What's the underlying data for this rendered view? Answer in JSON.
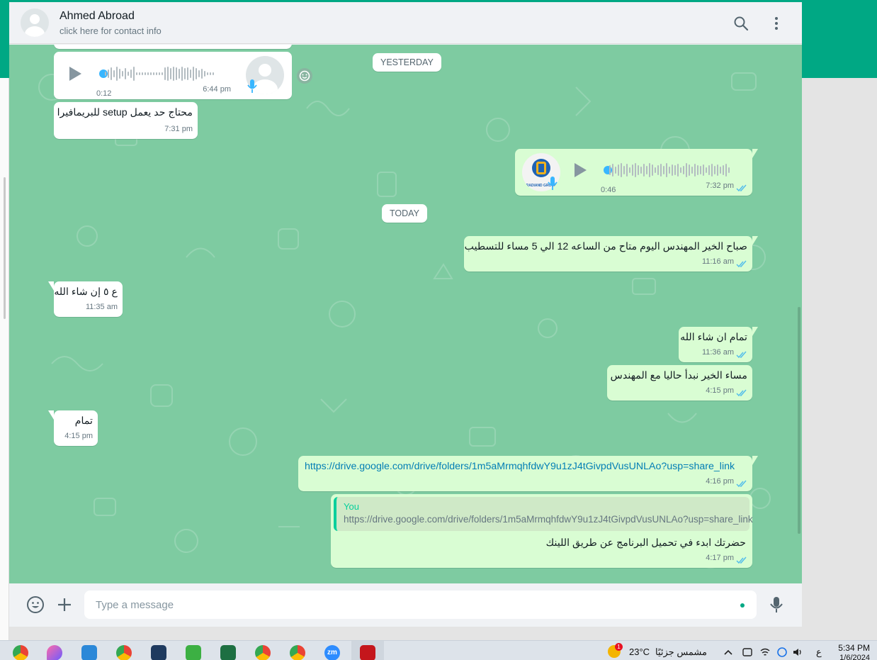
{
  "header": {
    "contact_name": "Ahmed Abroad",
    "contact_sub": "click here for contact info"
  },
  "icons": {
    "search": "search-icon",
    "menu": "more-vertical-icon",
    "emoji": "emoji-icon",
    "attach": "plus-icon",
    "mic": "mic-icon",
    "read": "double-check-icon",
    "react": "emoji-react-icon"
  },
  "colors": {
    "accent": "#00a884",
    "chat_bg": "#7ecba1",
    "out_bubble": "#d9fdd3",
    "in_bubble": "#ffffff",
    "link": "#027eb5",
    "read_ticks": "#53bdeb"
  },
  "dates": {
    "yesterday": "YESTERDAY",
    "today": "TODAY"
  },
  "messages": {
    "voice_in": {
      "duration": "0:12",
      "time": "6:44 pm"
    },
    "in_setup": {
      "text": "محتاج حد يعمل setup للبريمافيرا",
      "time": "7:31 pm"
    },
    "voice_out": {
      "duration": "0:46",
      "time": "7:32 pm",
      "logo_text": "RADIAND GROUP"
    },
    "out_morning": {
      "text": "صباح الخير المهندس اليوم متاح من الساعه 12 الي 5 مساء للتسطيب",
      "time": "11:16 am"
    },
    "in_five": {
      "text": "ع ٥ إن شاء الله",
      "time": "11:35 am"
    },
    "out_ok": {
      "text": "تمام ان شاء الله",
      "time": "11:36 am"
    },
    "out_evening": {
      "text": "مساء الخير نبدأ حاليا مع المهندس",
      "time": "4:15 pm"
    },
    "in_tamam": {
      "text": "تمام",
      "time": "4:15 pm"
    },
    "out_link": {
      "text": "https://drive.google.com/drive/folders/1m5aMrmqhfdwY9u1zJ4tGivpdVusUNLAo?usp=share_link",
      "time": "4:16 pm"
    },
    "out_reply": {
      "quote_name": "You",
      "quote_text": "https://drive.google.com/drive/folders/1m5aMrmqhfdwY9u1zJ4tGivpdVusUNLAo?usp=share_link",
      "text": "حضرتك ابدء في تحميل البرنامج عن طريق اللينك",
      "time": "4:17 pm"
    }
  },
  "composer": {
    "placeholder": "Type a message"
  },
  "taskbar": {
    "weather_temp": "23°C",
    "weather_text": "مشمس جزئيًا",
    "weather_badge": "1",
    "lang": "ع",
    "time": "5:34 PM",
    "date": "1/6/2024",
    "apps": [
      "chrome-icon",
      "paint-icon",
      "photos-icon",
      "chrome-profile-icon",
      "app-icon",
      "camtasia-icon",
      "excel-icon",
      "chrome-profile-icon",
      "chrome-profile-icon",
      "zoom-icon",
      "acrobat-icon"
    ],
    "zoom_label": "zm"
  }
}
